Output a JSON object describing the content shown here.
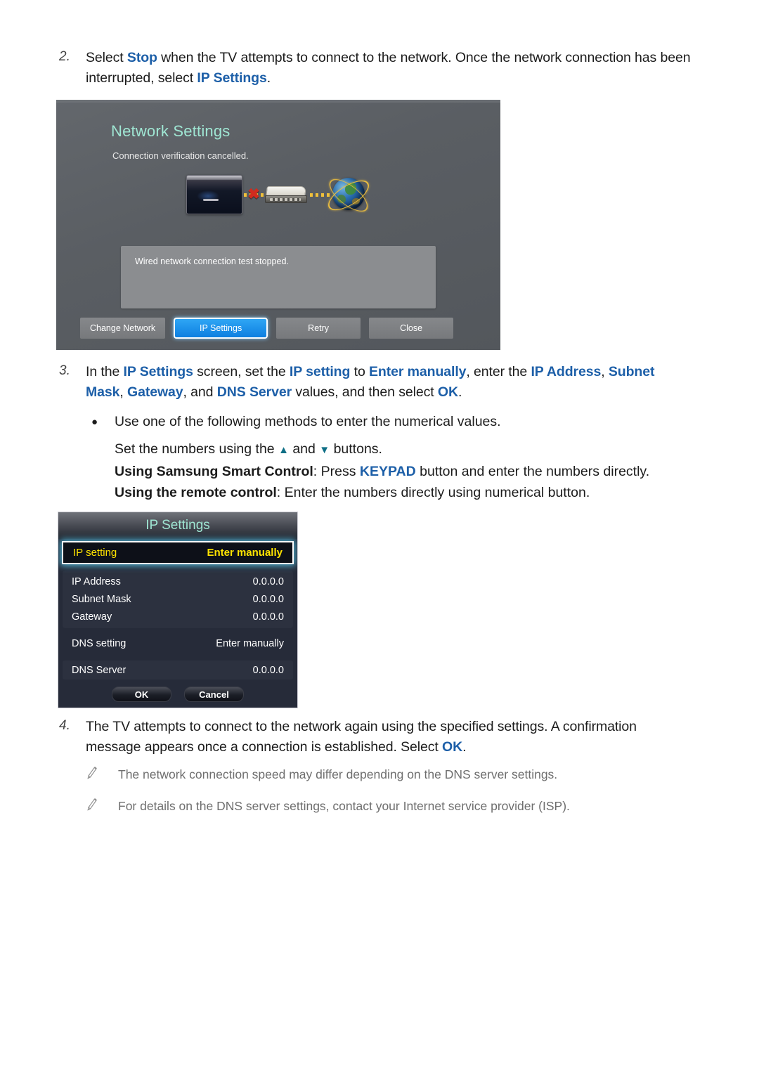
{
  "steps": {
    "two": {
      "number": "2.",
      "parts": [
        {
          "t": "Select ",
          "s": "plain"
        },
        {
          "t": "Stop",
          "s": "link"
        },
        {
          "t": " when the TV attempts to connect to the network. Once the network connection has been interrupted, select ",
          "s": "plain"
        },
        {
          "t": "IP Settings",
          "s": "link"
        },
        {
          "t": ".",
          "s": "plain"
        }
      ]
    },
    "three": {
      "number": "3.",
      "parts": [
        {
          "t": "In the ",
          "s": "plain"
        },
        {
          "t": "IP Settings",
          "s": "link"
        },
        {
          "t": " screen, set the ",
          "s": "plain"
        },
        {
          "t": "IP setting",
          "s": "link"
        },
        {
          "t": " to ",
          "s": "plain"
        },
        {
          "t": "Enter manually",
          "s": "link"
        },
        {
          "t": ", enter the ",
          "s": "plain"
        },
        {
          "t": "IP Address",
          "s": "link"
        },
        {
          "t": ", ",
          "s": "plain"
        },
        {
          "t": "Subnet Mask",
          "s": "link"
        },
        {
          "t": ", ",
          "s": "plain"
        },
        {
          "t": "Gateway",
          "s": "link"
        },
        {
          "t": ", and ",
          "s": "plain"
        },
        {
          "t": "DNS Server",
          "s": "link"
        },
        {
          "t": " values, and then select ",
          "s": "plain"
        },
        {
          "t": "OK",
          "s": "link"
        },
        {
          "t": ".",
          "s": "plain"
        }
      ]
    },
    "four": {
      "number": "4.",
      "parts": [
        {
          "t": "The TV attempts to connect to the network again using the specified settings. A confirmation message appears once a connection is established. Select ",
          "s": "plain"
        },
        {
          "t": "OK",
          "s": "link"
        },
        {
          "t": ".",
          "s": "plain"
        }
      ]
    }
  },
  "bullet": {
    "marker": "●",
    "lead": "Use one of the following methods to enter the numerical values.",
    "line_set_pre": "Set the numbers using the ",
    "arrow_up": "▲",
    "line_set_mid": " and ",
    "arrow_down": "▼",
    "line_set_post": " buttons.",
    "smart_label": "Using Samsung Smart Control",
    "smart_pre": ": Press ",
    "smart_key": "KEYPAD",
    "smart_post": " button and enter the numbers directly.",
    "remote_label": "Using the remote control",
    "remote_text": ": Enter the numbers directly using numerical button."
  },
  "notes": [
    "The network connection speed may differ depending on the DNS server settings.",
    "For details on the DNS server settings, contact your Internet service provider (ISP)."
  ],
  "network_settings_screen": {
    "title": "Network Settings",
    "subtitle": "Connection verification cancelled.",
    "message": "Wired network connection test stopped.",
    "buttons": [
      {
        "label": "Change Network",
        "selected": false
      },
      {
        "label": "IP Settings",
        "selected": true
      },
      {
        "label": "Retry",
        "selected": false
      },
      {
        "label": "Close",
        "selected": false
      }
    ],
    "diagram": {
      "tv": "tv-device-icon",
      "link_status": "x-mark-icon",
      "router": "router-device-icon",
      "internet": "globe-icon"
    }
  },
  "ip_settings_screen": {
    "title": "IP Settings",
    "selected_row": {
      "label": "IP setting",
      "value": "Enter manually"
    },
    "ip_group": [
      {
        "label": "IP Address",
        "value": "0.0.0.0"
      },
      {
        "label": "Subnet Mask",
        "value": "0.0.0.0"
      },
      {
        "label": "Gateway",
        "value": "0.0.0.0"
      }
    ],
    "dns_setting": {
      "label": "DNS setting",
      "value": "Enter manually"
    },
    "dns_server": {
      "label": "DNS Server",
      "value": "0.0.0.0"
    },
    "buttons": {
      "ok": "OK",
      "cancel": "Cancel"
    }
  },
  "colors": {
    "link_blue": "#1d5fa8",
    "teal_title": "#9fe6d3",
    "yellow_highlight": "#ffe400",
    "selected_button_blue": "#0d7fe0",
    "arrow_teal": "#0f6f86",
    "note_gray": "#6e6e6e"
  }
}
